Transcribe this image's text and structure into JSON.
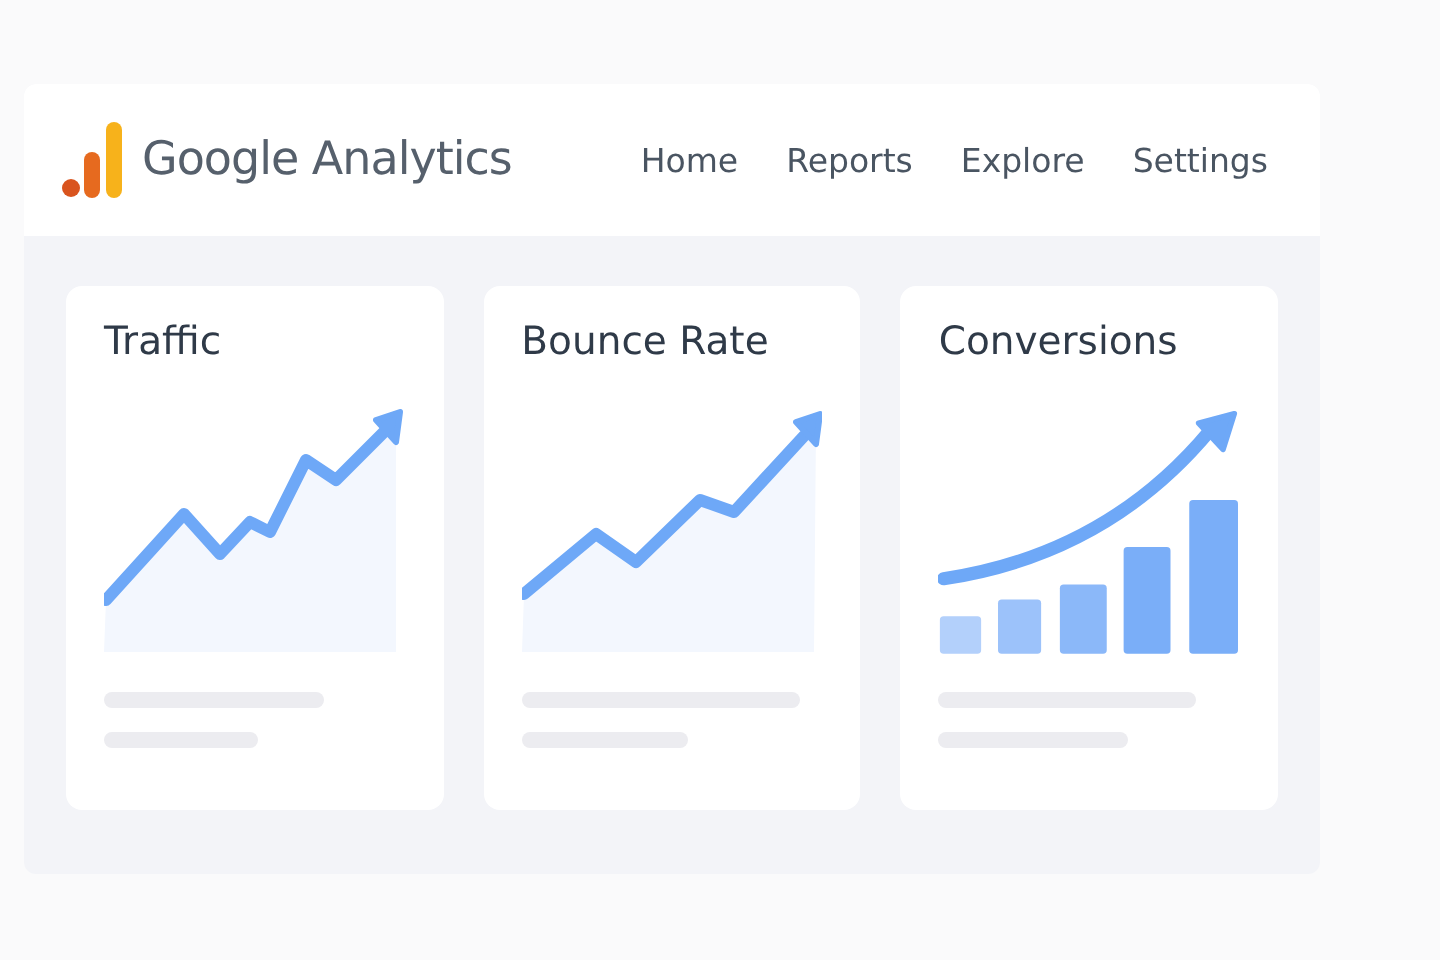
{
  "header": {
    "product_name": "Google Analytics",
    "nav": [
      {
        "label": "Home"
      },
      {
        "label": "Reports"
      },
      {
        "label": "Explore"
      },
      {
        "label": "Settings"
      }
    ]
  },
  "cards": [
    {
      "title": "Traffic",
      "kind": "line"
    },
    {
      "title": "Bounce Rate",
      "kind": "line"
    },
    {
      "title": "Conversions",
      "kind": "bars"
    }
  ]
}
